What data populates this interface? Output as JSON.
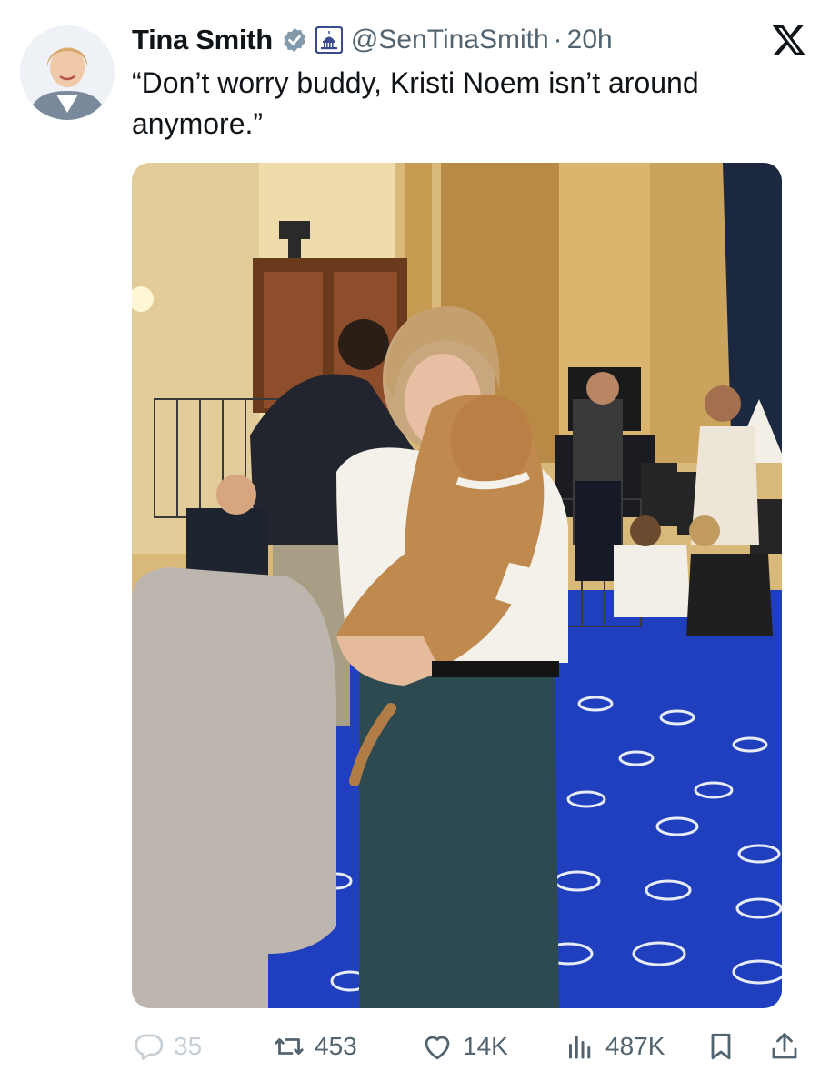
{
  "author": {
    "name": "Tina Smith",
    "handle": "@SenTinaSmith",
    "separator": "·",
    "timestamp": "20h",
    "verified": true,
    "affiliation_badge": "us-senate-capitol-icon"
  },
  "tweet": {
    "text": "“Don’t worry buddy, Kristi Noem isn’t around anymore.”"
  },
  "media": {
    "kind": "photo"
  },
  "metrics": {
    "replies": "35",
    "reposts": "453",
    "likes": "14K",
    "views": "487K"
  },
  "icons": {
    "verified": "verified-badge-icon",
    "platform": "x-logo-icon",
    "reply": "reply-icon",
    "repost": "repost-icon",
    "like": "heart-icon",
    "views": "views-icon",
    "bookmark": "bookmark-icon",
    "share": "share-icon"
  },
  "colors": {
    "text": "#0f1419",
    "secondary": "#536471",
    "verified_badge": "#829aab",
    "carpet": "#1f3fbf"
  }
}
